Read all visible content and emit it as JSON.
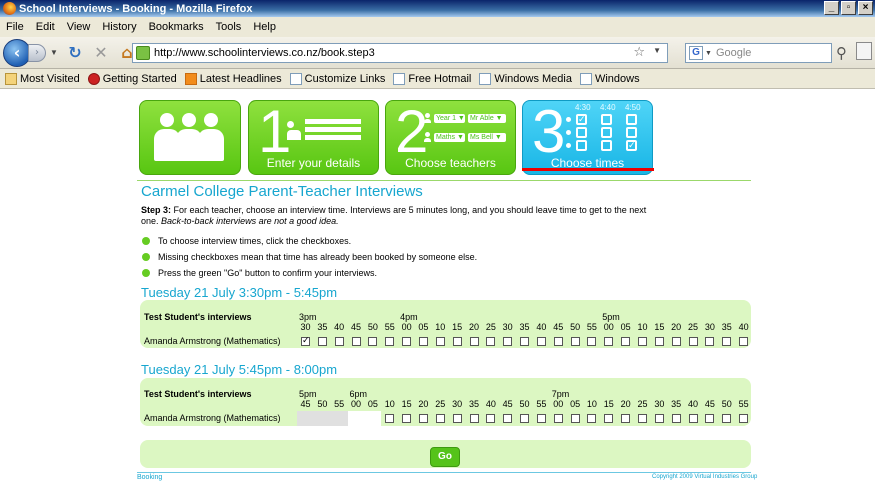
{
  "window": {
    "title": "School Interviews - Booking - Mozilla Firefox"
  },
  "menu": [
    "File",
    "Edit",
    "View",
    "History",
    "Bookmarks",
    "Tools",
    "Help"
  ],
  "nav": {
    "url": "http://www.schoolinterviews.co.nz/book.step3",
    "search_placeholder": "Google"
  },
  "bookmarks": [
    {
      "label": "Most Visited",
      "icon": "folder-icon"
    },
    {
      "label": "Getting Started",
      "icon": "firefox-icon"
    },
    {
      "label": "Latest Headlines",
      "icon": "rss-icon"
    },
    {
      "label": "Customize Links",
      "icon": "page-icon"
    },
    {
      "label": "Free Hotmail",
      "icon": "page-icon"
    },
    {
      "label": "Windows Media",
      "icon": "page-icon"
    },
    {
      "label": "Windows",
      "icon": "page-icon"
    }
  ],
  "steps": {
    "s1": {
      "num": "1",
      "label": "Enter your details"
    },
    "s2": {
      "num": "2",
      "label": "Choose teachers",
      "drop1": "Year 1 ▼",
      "drop2": "Mr Able ▼",
      "drop3": "Maths ▼",
      "drop4": "Ms Bell ▼"
    },
    "s3": {
      "num": "3",
      "label": "Choose times",
      "t1": "4:30",
      "t2": "4:40",
      "t3": "4:50"
    }
  },
  "page": {
    "title": "Carmel College Parent-Teacher Interviews",
    "step_label": "Step 3:",
    "intro": "For each teacher, choose an interview time. Interviews are 5 minutes long, and you should leave time to get to the next one.",
    "intro_em": "Back-to-back interviews are not a good idea.",
    "bullets": [
      "To choose interview times, click the checkboxes.",
      "Missing checkboxes mean that time has already been booked by someone else.",
      "Press the green \"Go\" button to confirm your interviews."
    ],
    "go": "Go",
    "footer_left": "Booking",
    "footer_right": "Copyright 2009 Virtual Industries Group"
  },
  "sessions": [
    {
      "date": "Tuesday 21 July 3:30pm - 5:45pm",
      "student": "Test Student's interviews",
      "teacher": "Amanda Armstrong (Mathematics)",
      "hours": [
        {
          "label": "3pm",
          "at": 0
        },
        {
          "label": "4pm",
          "at": 6
        },
        {
          "label": "5pm",
          "at": 18
        }
      ],
      "minutes": [
        "30",
        "35",
        "40",
        "45",
        "50",
        "55",
        "00",
        "05",
        "10",
        "15",
        "20",
        "25",
        "30",
        "35",
        "40",
        "45",
        "50",
        "55",
        "00",
        "05",
        "10",
        "15",
        "20",
        "25",
        "30",
        "35",
        "40"
      ],
      "slots": [
        true,
        false,
        false,
        false,
        false,
        false,
        false,
        false,
        false,
        false,
        false,
        false,
        false,
        false,
        false,
        false,
        false,
        false,
        false,
        false,
        false,
        false,
        false,
        false,
        false,
        false,
        false
      ]
    },
    {
      "date": "Tuesday 21 July 5:45pm - 8:00pm",
      "student": "Test Student's interviews",
      "teacher": "Amanda Armstrong (Mathematics)",
      "hours": [
        {
          "label": "5pm",
          "at": 0
        },
        {
          "label": "6pm",
          "at": 3
        },
        {
          "label": "7pm",
          "at": 15
        }
      ],
      "minutes": [
        "45",
        "50",
        "55",
        "00",
        "05",
        "10",
        "15",
        "20",
        "25",
        "30",
        "35",
        "40",
        "45",
        "50",
        "55",
        "00",
        "05",
        "10",
        "15",
        "20",
        "25",
        "30",
        "35",
        "40",
        "45",
        "50",
        "55"
      ],
      "slots": [
        null,
        null,
        null,
        null,
        null,
        false,
        false,
        false,
        false,
        false,
        false,
        false,
        false,
        false,
        false,
        false,
        false,
        false,
        false,
        false,
        false,
        false,
        false,
        false,
        false,
        false,
        false
      ]
    }
  ],
  "colors": {
    "accent": "#17a6cf",
    "green": "#58c612",
    "cyan": "#19b6e6",
    "selected_marker": "#ee0000",
    "panel": "#dcf7c2"
  }
}
